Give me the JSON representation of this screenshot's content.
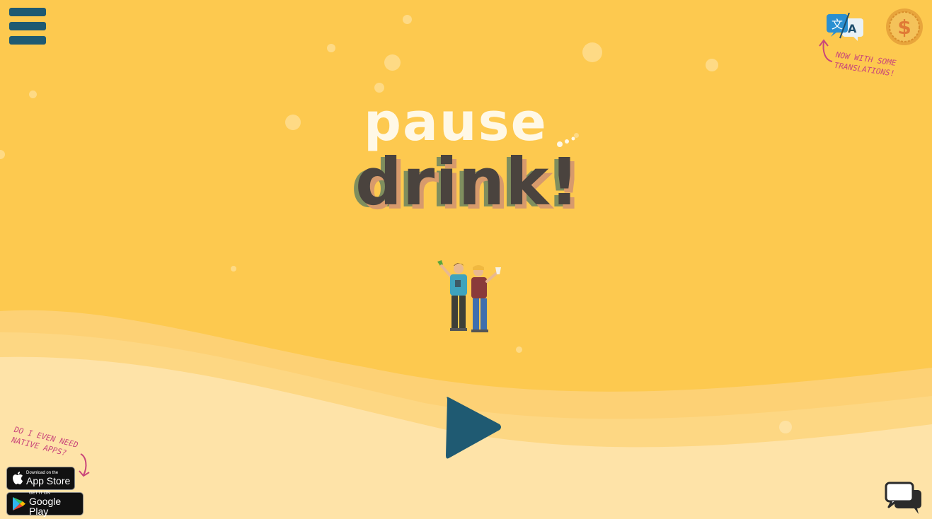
{
  "colors": {
    "background": "#fdc94f",
    "wave_light": "#fee3a8",
    "wave_mid": "#fdd783",
    "accent_teal": "#1f5a72",
    "note_pink": "#c9467a",
    "title_cream": "#fff8e6",
    "title_dark": "#4a433e"
  },
  "header": {
    "menu_icon": "hamburger-menu-icon",
    "translate_icon": "translate-icon",
    "coin_icon": "dollar-coin-icon",
    "translations_note": "NOW WITH SOME\nTRANSLATIONS!"
  },
  "title": {
    "line1": "pause",
    "line2": "drink!"
  },
  "hero": {
    "illustration": "two-people-toasting-drinks"
  },
  "main": {
    "play_icon": "play-icon"
  },
  "footer": {
    "native_apps_note": "DO I EVEN NEED\nNATIVE APPS?",
    "app_store": {
      "small": "Download on the",
      "big": "App Store"
    },
    "google_play": {
      "small": "GET IT ON",
      "big": "Google Play"
    },
    "chat_icon": "chat-bubbles-icon"
  }
}
